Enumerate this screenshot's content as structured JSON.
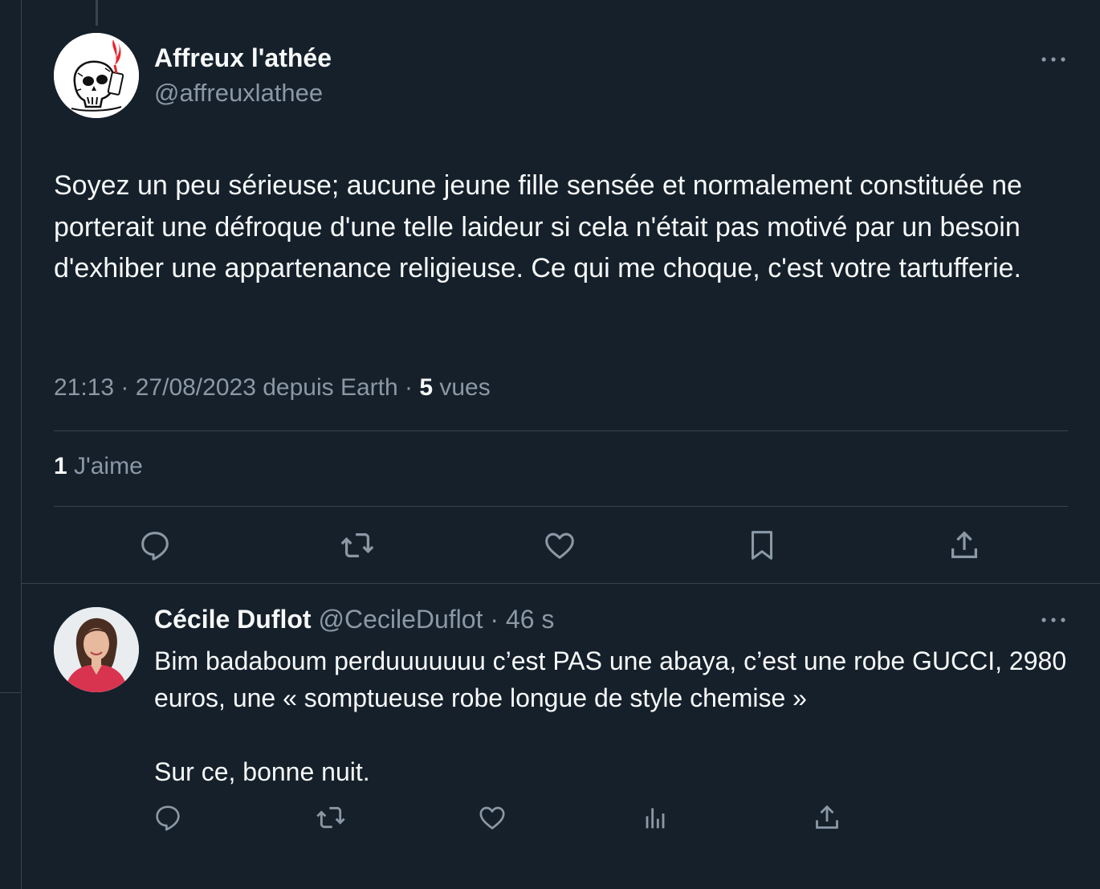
{
  "main_tweet": {
    "author_name": "Affreux l'athée",
    "author_handle": "@affreuxlathee",
    "avatar_icon": "skull-cigarette-avatar",
    "text": "Soyez un peu sérieuse; aucune jeune fille sensée et normalement constituée ne porterait une défroque d'une telle laideur si cela n'était pas motivé par un besoin d'exhiber une appartenance religieuse. Ce qui me choque, c'est votre tartufferie.",
    "timestamp": "21:13 · 27/08/2023 depuis Earth",
    "separator": " · ",
    "views_count": "5",
    "views_label": " vues",
    "likes_count": "1",
    "likes_label": " J'aime",
    "actions": [
      "reply-icon",
      "retweet-icon",
      "like-icon",
      "bookmark-icon",
      "share-icon"
    ]
  },
  "reply": {
    "author_name": "Cécile Duflot",
    "author_handle": "@CecileDuflot",
    "time": " · 46 s",
    "avatar_icon": "profile-photo-avatar",
    "paragraphs": [
      "Bim badaboum perduuuuuuu c’est PAS une abaya, c’est une robe GUCCI, 2980 euros, une « somptueuse robe longue de style chemise »",
      "Sur ce, bonne nuit."
    ],
    "actions": [
      "reply-icon",
      "retweet-icon",
      "like-icon",
      "views-icon",
      "share-icon"
    ]
  },
  "colors": {
    "background": "#15202b",
    "text": "#f7f9f9",
    "secondary": "#8b98a5",
    "border": "#38444d"
  }
}
